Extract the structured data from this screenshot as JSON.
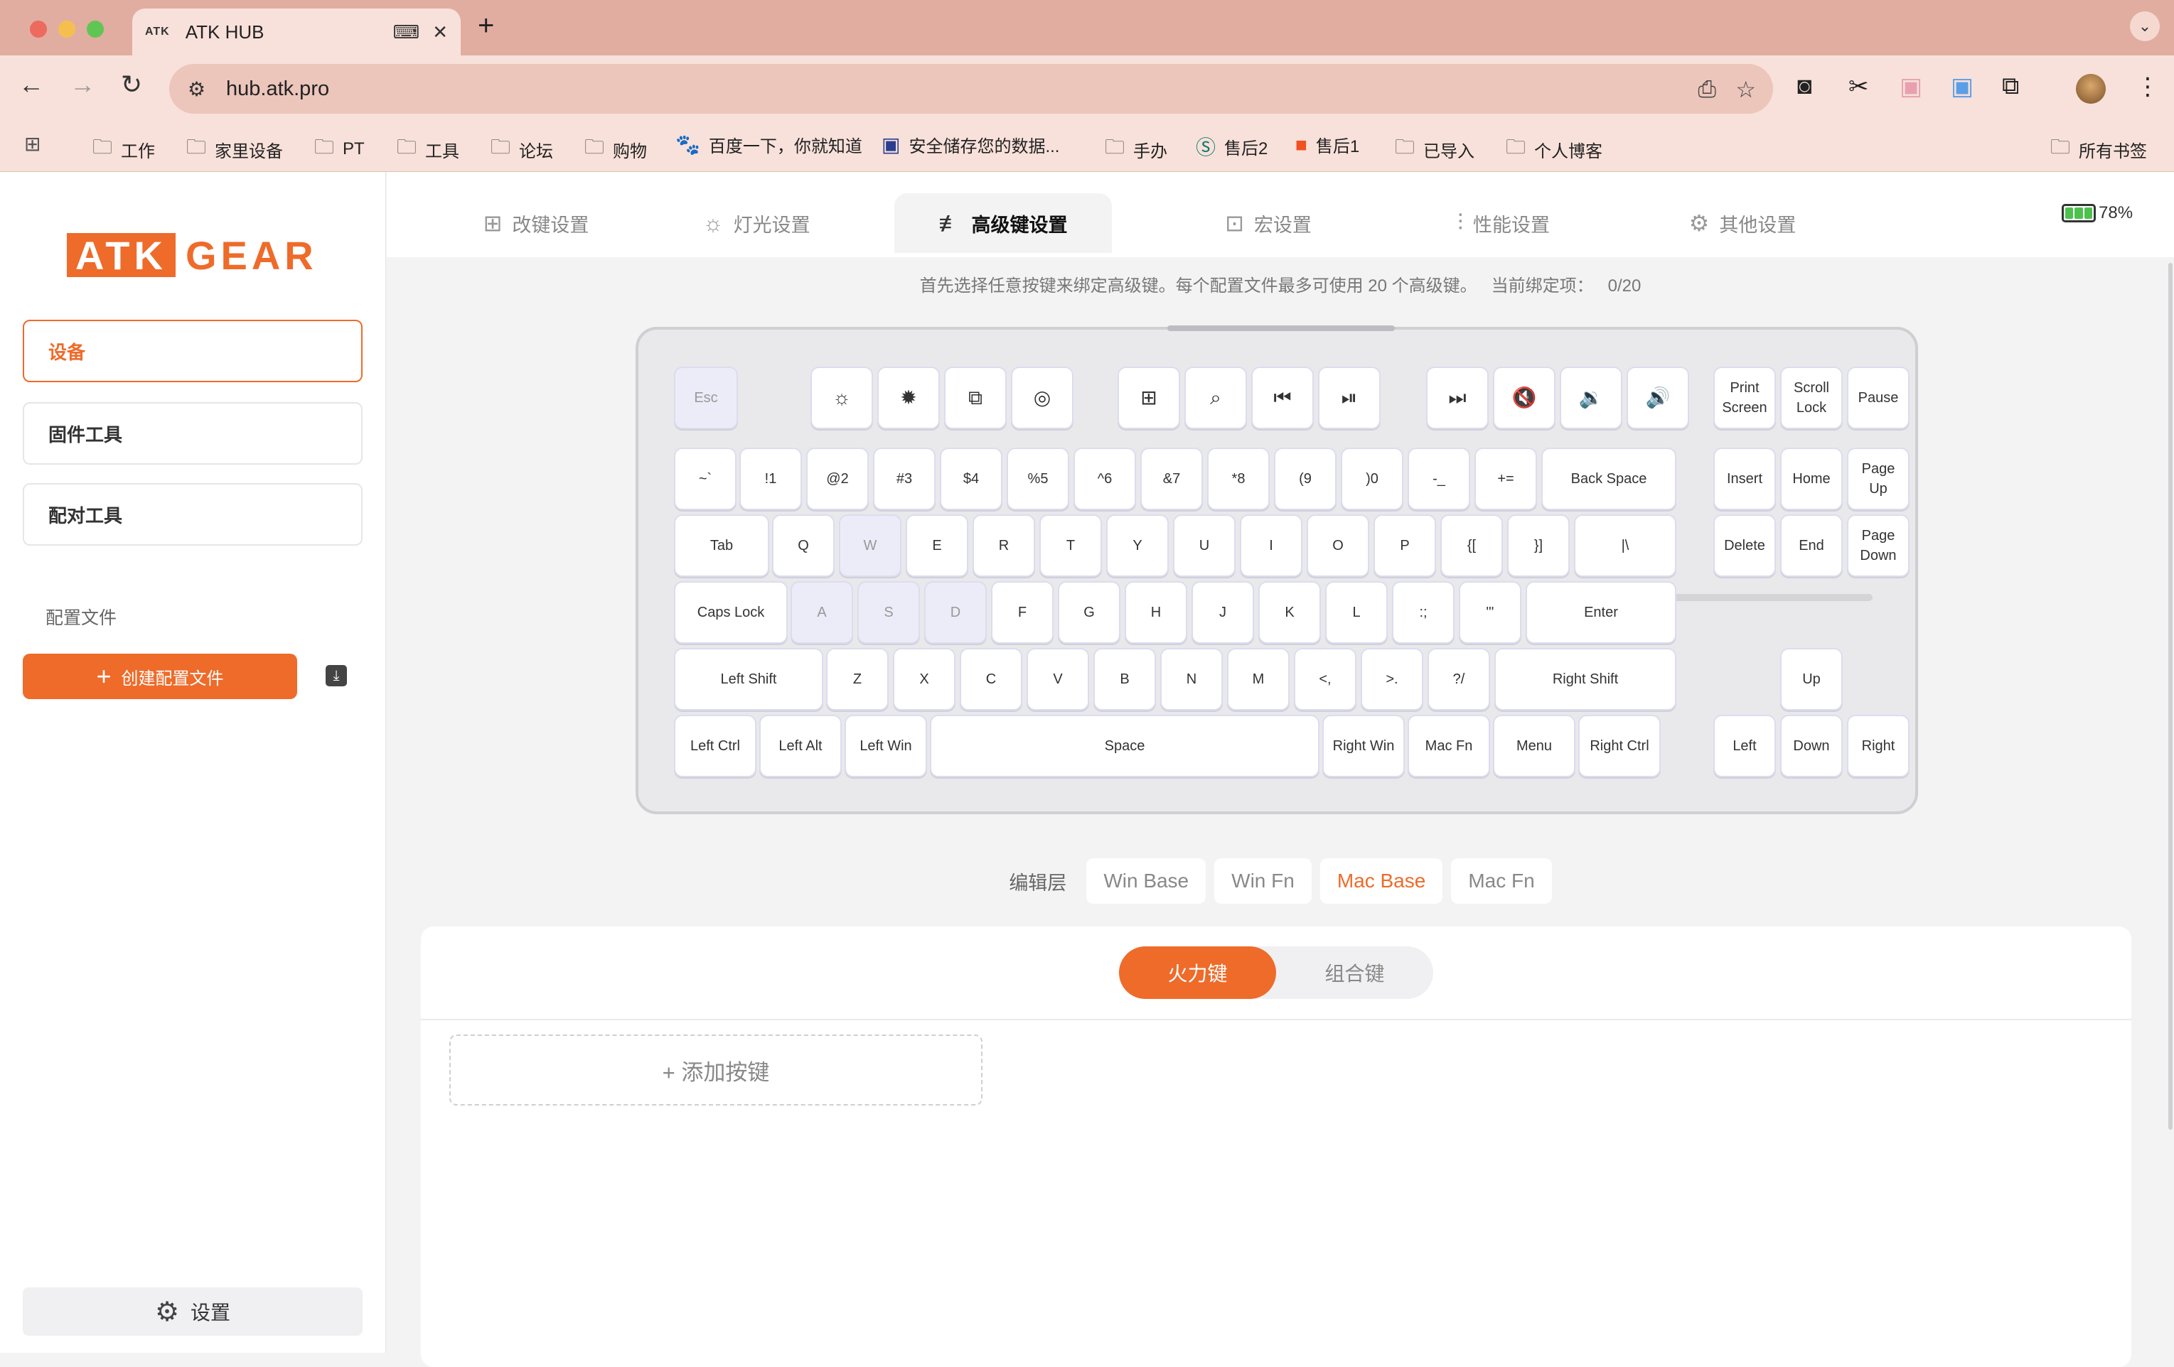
{
  "browser": {
    "tab_favicon": "ATK",
    "tab_title": "ATK HUB",
    "url": "hub.atk.pro",
    "bookmarks": [
      {
        "label": "工作",
        "icon": "folder-icon"
      },
      {
        "label": "家里设备",
        "icon": "folder-icon"
      },
      {
        "label": "PT",
        "icon": "folder-icon"
      },
      {
        "label": "工具",
        "icon": "folder-icon"
      },
      {
        "label": "论坛",
        "icon": "folder-icon"
      },
      {
        "label": "购物",
        "icon": "folder-icon"
      },
      {
        "label": "百度一下，你就知道",
        "icon": "baidu-icon"
      },
      {
        "label": "安全储存您的数据...",
        "icon": "site-icon"
      },
      {
        "label": "手办",
        "icon": "folder-icon"
      },
      {
        "label": "售后2",
        "icon": "sharepoint-icon"
      },
      {
        "label": "售后1",
        "icon": "microsoft-icon"
      },
      {
        "label": "已导入",
        "icon": "folder-icon"
      },
      {
        "label": "个人博客",
        "icon": "folder-icon"
      }
    ],
    "all_bookmarks": "所有书签"
  },
  "sidebar": {
    "logo_atk": "ATK",
    "logo_gear": "GEAR",
    "items": [
      {
        "label": "设备"
      },
      {
        "label": "固件工具"
      },
      {
        "label": "配对工具"
      }
    ],
    "profiles_label": "配置文件",
    "create_profile": "创建配置文件",
    "settings": "设置"
  },
  "tabs": [
    {
      "label": "改键设置",
      "icon": "keymap-icon"
    },
    {
      "label": "灯光设置",
      "icon": "light-icon"
    },
    {
      "label": "高级键设置",
      "icon": "advanced-key-icon"
    },
    {
      "label": "宏设置",
      "icon": "macro-icon"
    },
    {
      "label": "性能设置",
      "icon": "performance-icon"
    },
    {
      "label": "其他设置",
      "icon": "other-settings-icon"
    }
  ],
  "battery": "78%",
  "info": {
    "text": "首先选择任意按键来绑定高级键。每个配置文件最多可使用 20 个高级键。",
    "count_label": "当前绑定项：",
    "count": "0/20"
  },
  "keyboard_rows": [
    [
      "Esc",
      "brightness-down",
      "brightness-up",
      "task-view",
      "siri",
      "launchpad",
      "search",
      "prev-track",
      "play-pause",
      "next-track",
      "mute",
      "volume-down",
      "volume-up",
      "Print Screen",
      "Scroll Lock",
      "Pause"
    ],
    [
      "~`",
      "!1",
      "@2",
      "#3",
      "$4",
      "%5",
      "^6",
      "&7",
      "*8",
      "(9",
      ")0",
      "-_",
      "+=",
      "Back Space",
      "Insert",
      "Home",
      "Page Up"
    ],
    [
      "Tab",
      "Q",
      "W",
      "E",
      "R",
      "T",
      "Y",
      "U",
      "I",
      "O",
      "P",
      "{[",
      "}]",
      "|\\",
      "Delete",
      "End",
      "Page Down"
    ],
    [
      "Caps Lock",
      "A",
      "S",
      "D",
      "F",
      "G",
      "H",
      "J",
      "K",
      "L",
      ":;",
      "\"'",
      "Enter"
    ],
    [
      "Left Shift",
      "Z",
      "X",
      "C",
      "V",
      "B",
      "N",
      "M",
      "<,",
      ">.",
      "?/",
      "Right Shift",
      "Up"
    ],
    [
      "Left Ctrl",
      "Left Alt",
      "Left Win",
      "Space",
      "Right Win",
      "Mac Fn",
      "Menu",
      "Right Ctrl",
      "Left",
      "Down",
      "Right"
    ]
  ],
  "keys_highlighted": [
    "Esc",
    "W",
    "A",
    "S",
    "D"
  ],
  "layer": {
    "label": "编辑层",
    "options": [
      "Win Base",
      "Win Fn",
      "Mac Base",
      "Mac Fn"
    ],
    "selected": "Mac Base"
  },
  "panel": {
    "segments": [
      "火力键",
      "组合键"
    ],
    "selected": "火力键",
    "add_key": "+ 添加按键"
  },
  "colors": {
    "accent": "#ee6b2a",
    "chrome": "#e1ada1",
    "toolbar": "#f8e1da"
  }
}
